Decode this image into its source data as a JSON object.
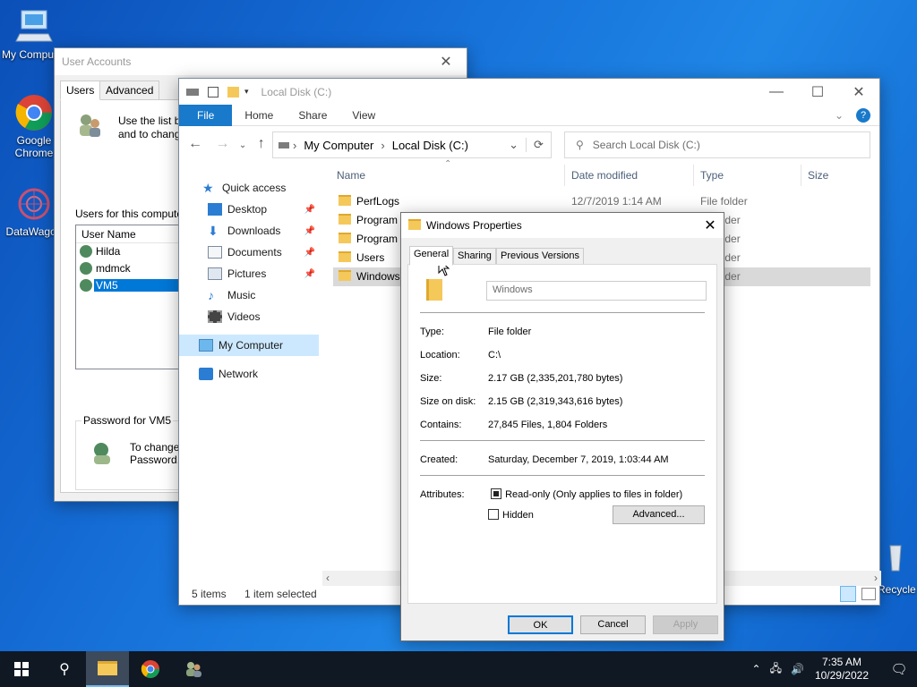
{
  "desktop": {
    "icons": [
      {
        "label": "My Computer"
      },
      {
        "label": "Google Chrome"
      },
      {
        "label": "DataWagon"
      },
      {
        "label": "Recycle Bin"
      }
    ]
  },
  "user_accounts": {
    "title": "User Accounts",
    "tabs": [
      "Users",
      "Advanced"
    ],
    "intro": "Use the list below to grant or deny users access to your computer, and to change passwords and other settings.",
    "intro_visible": "Use the list b",
    "intro_visible2": "and to chang",
    "list_caption": "Users for this compute",
    "column_header": "User Name",
    "users": [
      "Hilda",
      "mdmck",
      "VM5"
    ],
    "password_group": "Password for VM5",
    "password_text1": "To change",
    "password_text2": "Password."
  },
  "explorer": {
    "title": "Local Disk (C:)",
    "ribbon_tabs": [
      "File",
      "Home",
      "Share",
      "View"
    ],
    "breadcrumb": [
      "My Computer",
      "Local Disk (C:)"
    ],
    "search_placeholder": "Search Local Disk (C:)",
    "nav": {
      "quick_access": "Quick access",
      "items": [
        "Desktop",
        "Downloads",
        "Documents",
        "Pictures",
        "Music",
        "Videos"
      ],
      "my_computer": "My Computer",
      "network": "Network"
    },
    "columns": [
      "Name",
      "Date modified",
      "Type",
      "Size"
    ],
    "files": [
      {
        "name": "PerfLogs",
        "date": "12/7/2019 1:14 AM",
        "type": "File folder"
      },
      {
        "name": "Program",
        "date": "",
        "type": "older"
      },
      {
        "name": "Program",
        "date": "",
        "type": "older"
      },
      {
        "name": "Users",
        "date": "",
        "type": "older"
      },
      {
        "name": "Windows",
        "date": "",
        "type": "older"
      }
    ],
    "status_items": "5 items",
    "status_selected": "1 item selected"
  },
  "properties": {
    "title": "Windows Properties",
    "tabs": [
      "General",
      "Sharing",
      "Previous Versions"
    ],
    "name_value": "Windows",
    "rows": [
      {
        "label": "Type:",
        "value": "File folder"
      },
      {
        "label": "Location:",
        "value": "C:\\"
      },
      {
        "label": "Size:",
        "value": "2.17 GB (2,335,201,780 bytes)"
      },
      {
        "label": "Size on disk:",
        "value": "2.15 GB (2,319,343,616 bytes)"
      },
      {
        "label": "Contains:",
        "value": "27,845 Files, 1,804 Folders"
      }
    ],
    "created_label": "Created:",
    "created_value": "Saturday, December 7, 2019, 1:03:44 AM",
    "attributes_label": "Attributes:",
    "readonly_label": "Read-only (Only applies to files in folder)",
    "hidden_label": "Hidden",
    "advanced_button": "Advanced...",
    "ok": "OK",
    "cancel": "Cancel",
    "apply": "Apply"
  },
  "taskbar": {
    "time": "7:35 AM",
    "date": "10/29/2022"
  },
  "colors": {
    "desktop_blue": "#1670d8",
    "selection": "#cce8ff",
    "ribbon_file": "#1979ca",
    "taskbar": "#101823"
  }
}
